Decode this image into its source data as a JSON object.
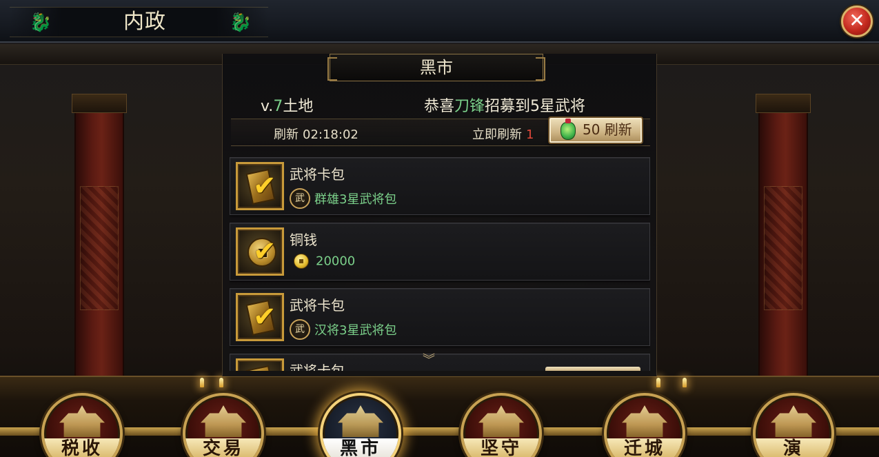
{
  "window": {
    "title": "内政",
    "close_label": "✕"
  },
  "panel": {
    "header": "黑市",
    "land_info": {
      "prefix": "v.",
      "level": "7",
      "suffix": "土地"
    },
    "broadcast": {
      "prefix": "恭喜",
      "name": "刀锋",
      "suffix": "招募到5星武将"
    },
    "refresh_label": "刷新",
    "refresh_timer": "02:18:02",
    "instant_refresh_label": "立即刷新",
    "instant_refresh_count": "1",
    "refresh_button_label": "50 刷新",
    "scroll_hint": "︾"
  },
  "items": [
    {
      "title": "武将卡包",
      "badge": "武",
      "detail": "群雄3星武将包",
      "icon": "card-pack-icon"
    },
    {
      "title": "铜钱",
      "detail": "20000",
      "icon": "coin-icon"
    },
    {
      "title": "武将卡包",
      "badge": "武",
      "detail": "汉将3星武将包",
      "icon": "card-pack-icon"
    },
    {
      "title": "武将卡包",
      "icon": "card-pack-icon"
    }
  ],
  "bottom_nav": [
    {
      "label": "税收",
      "active": false
    },
    {
      "label": "交易",
      "active": false
    },
    {
      "label": "黑市",
      "active": true
    },
    {
      "label": "坚守",
      "active": false
    },
    {
      "label": "迁城",
      "active": false
    },
    {
      "label": "演",
      "active": false
    }
  ],
  "colors": {
    "accent_gold": "#c89a3a",
    "highlight_green": "#7bd08a",
    "count_red": "#e0473a",
    "close_red": "#c2281d"
  }
}
